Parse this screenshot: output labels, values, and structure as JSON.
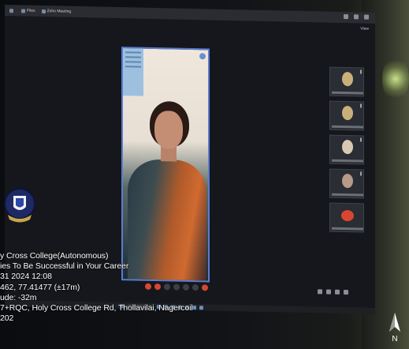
{
  "window": {
    "titlebar_items": [
      "",
      "Files",
      "Zoho Meeting"
    ],
    "view_label": "View"
  },
  "meeting": {
    "participants": [
      {
        "name": "",
        "avatar": "photo"
      },
      {
        "name": "",
        "avatar": "photo"
      },
      {
        "name": "",
        "avatar": "photo"
      },
      {
        "name": "",
        "avatar": "photo"
      },
      {
        "name": "",
        "avatar": "red-initials"
      }
    ],
    "controls_count": 7
  },
  "stamp": {
    "lines": [
      "y Cross College(Autonomous)",
      "ies To Be Successful in Your Career",
      "31 2024 12:08",
      "462, 77.41477 (±17m)",
      "ude: -32m",
      "7+RQC, Holy Cross College Rd, Thollavilai, Nagercoil",
      "202"
    ],
    "compass_letter": "N"
  },
  "colors": {
    "highlight_border": "#5b7bd0",
    "end_call_red": "#d8462f",
    "screen_bg": "#15171c"
  },
  "icons": [
    "college-crest-icon",
    "compass-icon",
    "mic-icon",
    "camera-icon",
    "end-call-icon",
    "more-options-icon"
  ]
}
